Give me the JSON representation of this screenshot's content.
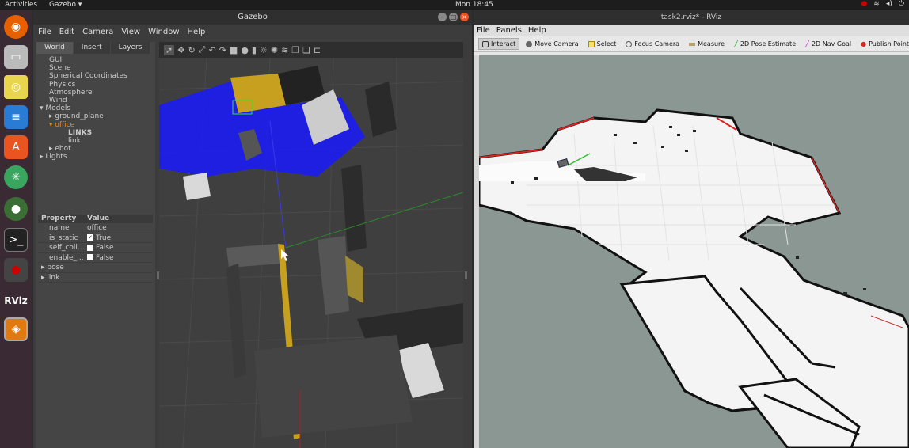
{
  "topbar": {
    "activities": "Activities",
    "app_menu": "Gazebo ▾",
    "clock": "Mon 18:45",
    "tray_icons": [
      "record-icon",
      "wifi-icon",
      "volume-icon",
      "power-icon"
    ]
  },
  "dock": {
    "items": [
      "firefox-icon",
      "files-icon",
      "rhythmbox-icon",
      "writer-icon",
      "software-icon",
      "atom-icon",
      "chrome-icon",
      "terminal-icon",
      "recorder-icon",
      "rviz-icon",
      "gazebo-icon"
    ],
    "rviz_label": "RViz"
  },
  "gazebo": {
    "title": "Gazebo",
    "menu": [
      "File",
      "Edit",
      "Camera",
      "View",
      "Window",
      "Help"
    ],
    "tabs": [
      "World",
      "Insert",
      "Layers"
    ],
    "tree": {
      "gui": "GUI",
      "scene": "Scene",
      "spherical": "Spherical Coordinates",
      "physics": "Physics",
      "atmosphere": "Atmosphere",
      "wind": "Wind",
      "models": "Models",
      "ground_plane": "ground_plane",
      "office": "office",
      "links": "LINKS",
      "link": "link",
      "ebot": "ebot",
      "lights": "Lights"
    },
    "properties": {
      "header_property": "Property",
      "header_value": "Value",
      "rows": [
        {
          "name": "name",
          "value": "office"
        },
        {
          "name": "is_static",
          "value": "True"
        },
        {
          "name": "self_coll...",
          "value": "False"
        },
        {
          "name": "enable_...",
          "value": "False"
        }
      ],
      "pose": "pose",
      "link": "link"
    }
  },
  "rviz": {
    "title": "task2.rviz* - RViz",
    "menu": [
      "File",
      "Panels",
      "Help"
    ],
    "tools": [
      "Interact",
      "Move Camera",
      "Select",
      "Focus Camera",
      "Measure",
      "2D Pose Estimate",
      "2D Nav Goal",
      "Publish Point"
    ]
  },
  "colors": {
    "accent": "#e95420",
    "selected_tree": "#e88a1d",
    "laser": "#1a1aff",
    "rviz_bg": "#8a9793"
  }
}
